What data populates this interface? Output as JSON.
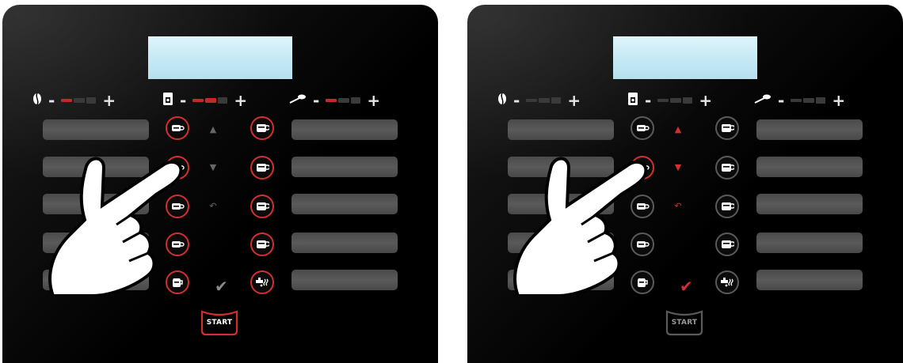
{
  "panels": [
    {
      "id": "left",
      "state": "active",
      "start_label": "START",
      "controls": {
        "strength": {
          "icon": "coffee-bean-icon",
          "minus": "-",
          "plus": "+",
          "level": 1
        },
        "quantity": {
          "icon": "water-tank-icon",
          "minus": "-",
          "plus": "+",
          "level": 2
        },
        "milk": {
          "icon": "milk-spoon-icon",
          "minus": "-",
          "plus": "+",
          "level": 1
        }
      },
      "nav": {
        "up_icon": "triangle-up-icon",
        "down_icon": "triangle-down-icon",
        "back_icon": "back-arrow-icon",
        "confirm_icon": "checkmark-icon"
      },
      "colors": {
        "accent": "#d32f2f",
        "ring": "#d32f2f"
      }
    },
    {
      "id": "right",
      "state": "navigation",
      "start_label": "START",
      "controls": {
        "strength": {
          "icon": "coffee-bean-icon",
          "minus": "-",
          "plus": "+",
          "level": 0
        },
        "quantity": {
          "icon": "water-tank-icon",
          "minus": "-",
          "plus": "+",
          "level": 0
        },
        "milk": {
          "icon": "milk-spoon-icon",
          "minus": "-",
          "plus": "+",
          "level": 0
        }
      },
      "nav": {
        "up_icon": "triangle-up-icon",
        "down_icon": "triangle-down-icon",
        "back_icon": "back-arrow-icon",
        "confirm_icon": "checkmark-icon"
      },
      "colors": {
        "accent": "#d32f2f",
        "ring": "#5a5a5a"
      }
    }
  ],
  "beverage_buttons": {
    "left_column": [
      "cup-icon",
      "cup-icon",
      "cup-icon",
      "cup-icon",
      "jug-icon"
    ],
    "right_column": [
      "mug-icon",
      "mug-icon",
      "mug-icon",
      "mug-icon",
      "hot-water-icon"
    ]
  },
  "symbols": {
    "check": "✔",
    "up": "▲",
    "down": "▼",
    "back": "↶"
  }
}
